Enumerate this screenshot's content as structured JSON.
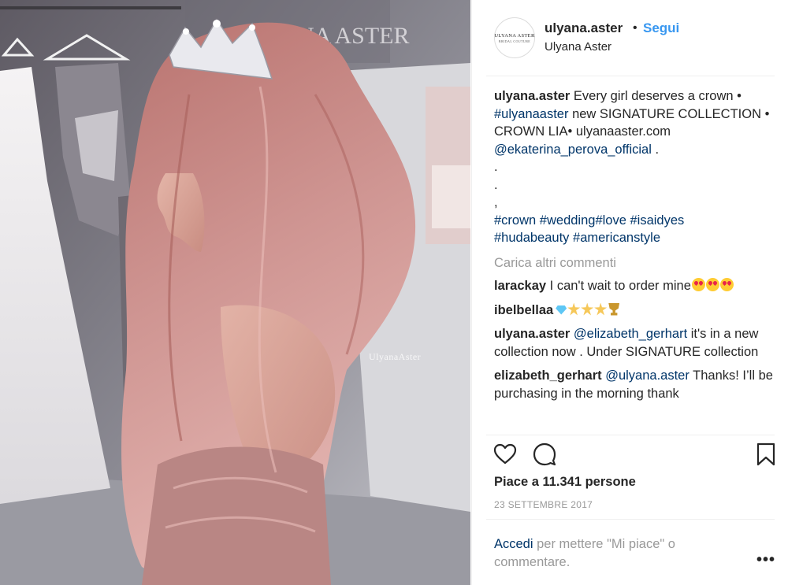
{
  "header": {
    "avatar_brand": "ULYANA ASTER",
    "avatar_sub": "BRIDAL COUTURE",
    "username": "ulyana.aster",
    "separator": "•",
    "follow_label": "Segui",
    "display_name": "Ulyana Aster"
  },
  "photo": {
    "watermark": "UlyanaAster",
    "backdrop_sign": "ULYANA ASTER"
  },
  "caption": {
    "username": "ulyana.aster",
    "text_1": " Every girl deserves a crown • ",
    "tag_1": "#ulyanaaster",
    "text_2": " new SIGNATURE COLLECTION • CROWN LIA• ulyanaaster.com ",
    "mention": "@ekaterina_perova_official",
    "text_3": " .",
    "dots": [
      ".",
      ".",
      ","
    ],
    "hashtags": [
      "#crown",
      "#wedding",
      "#love",
      "#isaidyes",
      "#hudabeauty",
      "#americanstyle"
    ]
  },
  "load_more": "Carica altri commenti",
  "comments": [
    {
      "user": "larackay",
      "text": " I can't wait to order mine"
    },
    {
      "user": "ibelbellaa",
      "text": ""
    },
    {
      "user": "ulyana.aster",
      "mention": "@elizabeth_gerhart",
      "text": " it's in a new collection now . Under SIGNATURE collection"
    },
    {
      "user": "elizabeth_gerhart",
      "mention": "@ulyana.aster",
      "text": " Thanks! I’ll be purchasing in the morning thank"
    }
  ],
  "icons": {
    "like": "heart-outline-icon",
    "comment": "speech-bubble-icon",
    "save": "bookmark-icon",
    "more": "ellipsis-icon"
  },
  "likes": "Piace a 11.341 persone",
  "date": "23 SETTEMBRE 2017",
  "login": {
    "link": "Accedi",
    "text": " per mettere \"Mi piace\" o commentare."
  },
  "more_label": "•••",
  "colors": {
    "link_blue": "#3897f0",
    "hashtag_blue": "#003569",
    "muted_gray": "#999999",
    "text": "#262626",
    "hair_pink": "#c98a86"
  }
}
